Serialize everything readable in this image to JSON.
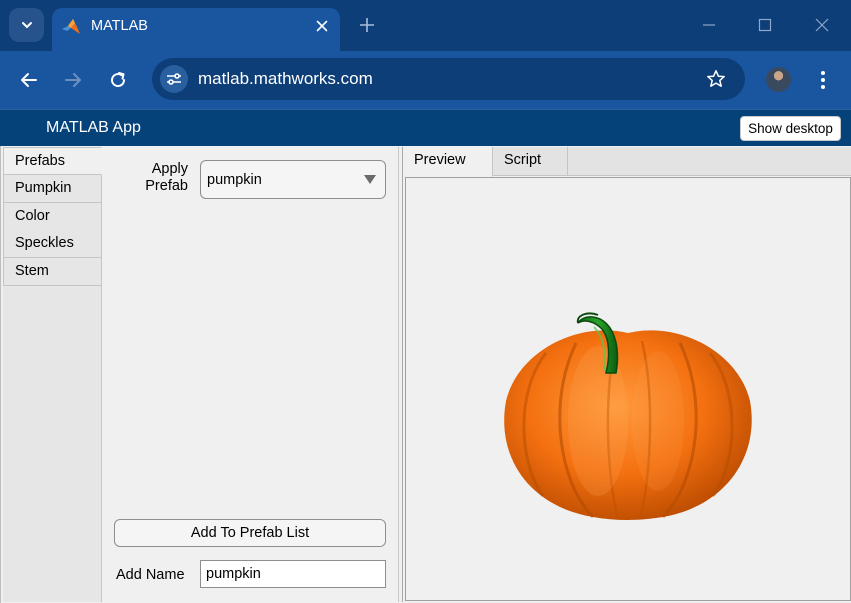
{
  "browser": {
    "tab_title": "MATLAB",
    "url": "matlab.mathworks.com",
    "icons": {
      "tab_search": "chevron-down-icon",
      "favicon": "matlab-logo-icon",
      "close": "close-icon",
      "new_tab": "plus-icon",
      "back": "arrow-left-icon",
      "forward": "arrow-right-icon",
      "reload": "reload-icon",
      "site_info": "tune-icon",
      "bookmark": "star-icon",
      "menu": "kebab-icon"
    }
  },
  "app": {
    "title": "MATLAB App",
    "show_desktop_label": "Show desktop"
  },
  "side_tabs": [
    {
      "label": "Prefabs",
      "active": true
    },
    {
      "label": "Pumpkin",
      "active": false
    },
    {
      "label": "Color",
      "active": false
    },
    {
      "label": "Speckles",
      "active": false
    },
    {
      "label": "Stem",
      "active": false
    }
  ],
  "prefabs": {
    "apply_label_line1": "Apply",
    "apply_label_line2": "Prefab",
    "selected_prefab": "pumpkin",
    "add_button_label": "Add To Prefab List",
    "add_name_label": "Add Name",
    "add_name_value": "pumpkin"
  },
  "right_tabs": [
    {
      "label": "Preview",
      "active": true
    },
    {
      "label": "Script",
      "active": false
    }
  ],
  "colors": {
    "chrome_dark": "#0d3e78",
    "chrome": "#1a55a0",
    "app_bar": "#05427a",
    "pumpkin_orange": "#f26a0a",
    "stem_green": "#1a8a1a"
  }
}
